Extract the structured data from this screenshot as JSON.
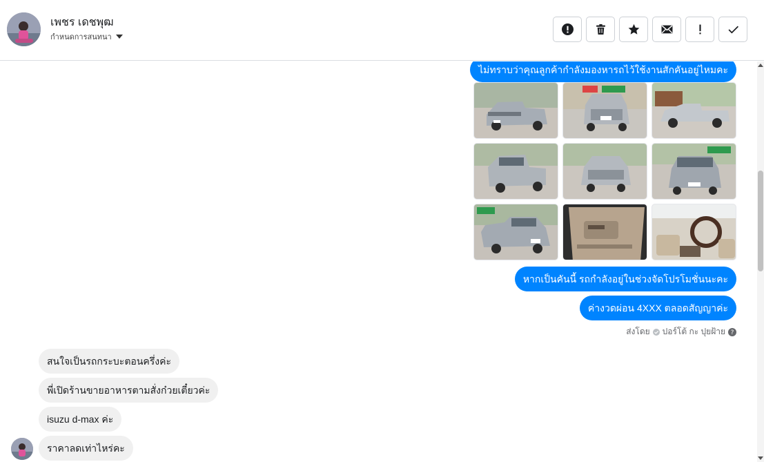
{
  "header": {
    "contact_name": "เพชร เดชพุฒ",
    "subtitle": "กำหนดการสนทนา",
    "actions": [
      {
        "name": "spam-button",
        "icon": "alert-circle-icon"
      },
      {
        "name": "delete-button",
        "icon": "trash-icon"
      },
      {
        "name": "star-button",
        "icon": "star-icon"
      },
      {
        "name": "mark-unread-button",
        "icon": "envelope-icon"
      },
      {
        "name": "important-button",
        "icon": "exclamation-icon"
      },
      {
        "name": "done-button",
        "icon": "check-icon"
      }
    ]
  },
  "thread": {
    "outgoing_top": "ไม่ทราบว่าคุณลูกค้ากำลังมองหารถไว้ใช้งานสักคันอยู่ไหมคะ",
    "photos": [
      {
        "name": "photo-front-left",
        "icon": "truck-photo"
      },
      {
        "name": "photo-rear-sign",
        "icon": "truck-photo"
      },
      {
        "name": "photo-side",
        "icon": "truck-photo"
      },
      {
        "name": "photo-rear-left",
        "icon": "truck-photo"
      },
      {
        "name": "photo-rear",
        "icon": "truck-photo"
      },
      {
        "name": "photo-front",
        "icon": "truck-photo"
      },
      {
        "name": "photo-front-right",
        "icon": "truck-photo"
      },
      {
        "name": "photo-door-interior",
        "icon": "interior-photo"
      },
      {
        "name": "photo-dashboard",
        "icon": "interior-photo"
      }
    ],
    "outgoing_promo": "หากเป็นคันนี้ รถกำลังอยู่ในช่วงจัดโปรโมชั่นนะคะ",
    "outgoing_installment": "ค่างวดผ่อน 4XXX ตลอดสัญญาค่ะ",
    "sent_by": "ส่งโดย",
    "sent_by_name": "ปอร์โต้ กะ ปุยฝ้าย",
    "incoming": [
      "สนใจเป็นรถกระบะตอนครึ่งค่ะ",
      "พี่เปิดร้านขายอาหารตามสั่งก๋วยเตี๋ยวค่ะ",
      "isuzu d-max ค่ะ",
      "ราคาลดเท่าไหร่คะ"
    ]
  },
  "colors": {
    "accent": "#0084ff",
    "incoming_bubble": "#f0f0f0"
  }
}
